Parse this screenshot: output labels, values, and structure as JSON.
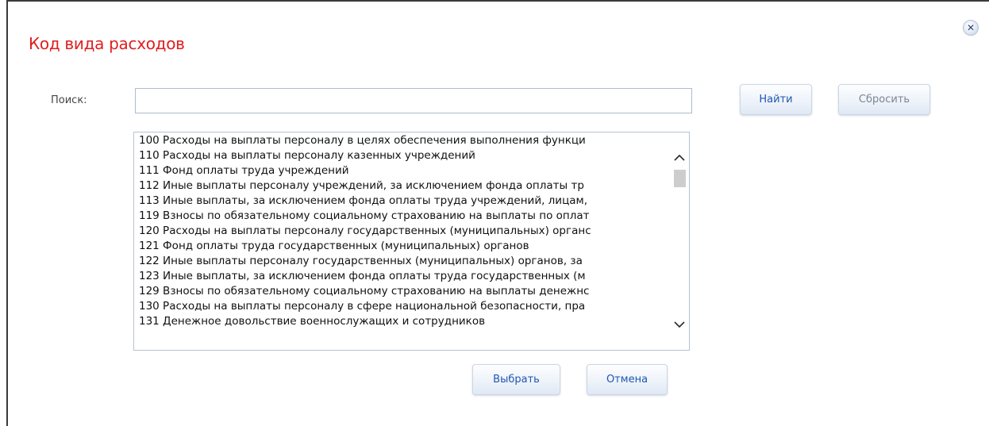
{
  "dialog": {
    "title": "Код вида расходов",
    "close_icon": "close-icon"
  },
  "search": {
    "label": "Поиск:",
    "value": "",
    "placeholder": "",
    "find_label": "Найти",
    "reset_label": "Сбросить"
  },
  "list": {
    "items": [
      {
        "label": "100 Расходы на выплаты персоналу в целях обеспечения выполнения функци"
      },
      {
        "label": "110 Расходы на выплаты персоналу казенных учреждений"
      },
      {
        "label": "111 Фонд оплаты труда учреждений"
      },
      {
        "label": "112 Иные выплаты персоналу учреждений, за исключением фонда оплаты тр"
      },
      {
        "label": "113 Иные выплаты, за исключением фонда оплаты труда учреждений, лицам,"
      },
      {
        "label": "119 Взносы по обязательному социальному страхованию на выплаты по оплат"
      },
      {
        "label": "120 Расходы на выплаты персоналу государственных (муниципальных) органс"
      },
      {
        "label": "121 Фонд оплаты труда государственных (муниципальных) органов"
      },
      {
        "label": "122 Иные выплаты персоналу государственных (муниципальных) органов, за"
      },
      {
        "label": "123 Иные выплаты, за исключением фонда оплаты труда государственных (м"
      },
      {
        "label": "129 Взносы по обязательному социальному страхованию на выплаты денежнс"
      },
      {
        "label": "130 Расходы на выплаты персоналу в сфере национальной безопасности, пра"
      },
      {
        "label": "131 Денежное довольствие военнослужащих и сотрудников"
      }
    ]
  },
  "footer": {
    "select_label": "Выбрать",
    "cancel_label": "Отмена"
  },
  "colors": {
    "title": "#e01e1e",
    "button_text": "#1f56b0",
    "button_disabled_text": "#7c8594"
  }
}
